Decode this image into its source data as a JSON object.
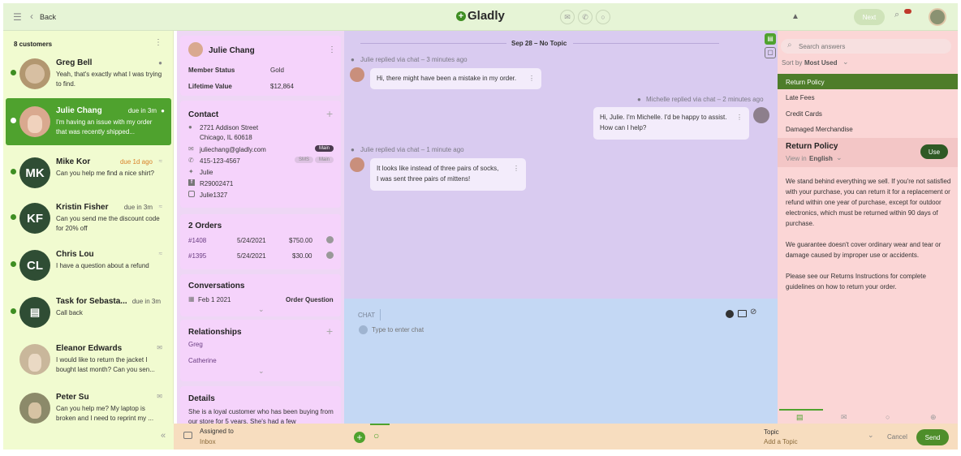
{
  "header": {
    "back_label": "Back",
    "logo": "Gladly",
    "next_label": "Next"
  },
  "customers": {
    "count_label": "8 customers",
    "items": [
      {
        "name": "Greg Bell",
        "due": "",
        "message": "Yeah, that's exactly what I was trying to find.",
        "initials": ""
      },
      {
        "name": "Julie Chang",
        "due": "due in 3m",
        "message": "I'm having an issue with my order that was recently shipped...",
        "initials": ""
      },
      {
        "name": "Mike Kor",
        "due": "due 1d ago",
        "message": "Can you help me find a nice shirt?",
        "initials": "MK"
      },
      {
        "name": "Kristin Fisher",
        "due": "due in 3m",
        "message": "Can you send me the discount code for 20% off",
        "initials": "KF"
      },
      {
        "name": "Chris Lou",
        "due": "",
        "message": "I have a question about a refund",
        "initials": "CL"
      },
      {
        "name": "Task for Sebasta...",
        "due": "due in 3m",
        "message": "Call back",
        "initials": ""
      },
      {
        "name": "Eleanor Edwards",
        "due": "",
        "message": "I would like to return the jacket I bought last month? Can you sen...",
        "initials": ""
      },
      {
        "name": "Peter Su",
        "due": "",
        "message": "Can you help me? My laptop is broken and I need to reprint my ...",
        "initials": ""
      }
    ]
  },
  "profile": {
    "name": "Julie Chang",
    "member_status_label": "Member Status",
    "member_status": "Gold",
    "lifetime_value_label": "Lifetime Value",
    "lifetime_value": "$12,864",
    "contact_title": "Contact",
    "address1": "2721 Addison Street",
    "address2": "Chicago, IL 60618",
    "email": "juliechang@gladly.com",
    "main_tag": "Main",
    "phone": "415-123-4567",
    "sms_tag": "SMS",
    "main_tag2": "Main",
    "twitter": "Julie",
    "facebook": "R29002471",
    "instagram": "Julie1327",
    "orders_title": "2 Orders",
    "orders": [
      {
        "id": "#1408",
        "date": "5/24/2021",
        "amount": "$750.00"
      },
      {
        "id": "#1395",
        "date": "5/24/2021",
        "amount": "$30.00"
      }
    ],
    "conversations_title": "Conversations",
    "conv_date": "Feb 1 2021",
    "conv_topic": "Order Question",
    "relationships_title": "Relationships",
    "rel1": "Greg",
    "rel2": "Catherine",
    "details_title": "Details",
    "details_text": "She is a loyal customer who has been buying from our store for 5 years. She's had a few"
  },
  "chat": {
    "date_divider": "Sep 28 – No Topic",
    "meta1": "Julie replied via chat – 3 minutes ago",
    "msg1": "Hi, there might have been a mistake in my order.",
    "meta2": "Michelle replied via chat – 2 minutes ago",
    "msg2a": "Hi, Julie. I'm Michelle. I'd be happy to assist.",
    "msg2b": "How can I help?",
    "meta3": "Julie replied via chat – 1 minute ago",
    "msg3a": "It looks like instead of three pairs of socks,",
    "msg3b": "I was sent three pairs of mittens!"
  },
  "compose": {
    "channel_label": "CHAT",
    "placeholder": "Type to enter chat"
  },
  "answers": {
    "search_placeholder": "Search answers",
    "sort_prefix": "Sort by",
    "sort_value": "Most Used",
    "items": [
      "Return Policy",
      "Late Fees",
      "Credit Cards",
      "Damaged Merchandise"
    ],
    "title": "Return Policy",
    "use_label": "Use",
    "view_prefix": "View in",
    "view_lang": "English",
    "para1": "We stand behind everything we sell. If you're not satisfied with your purchase, you can return it for a replacement or refund within one year of purchase, except for outdoor electronics, which must be returned within 90 days of purchase.",
    "para2": "We guarantee doesn't cover ordinary wear and tear or damage caused by improper use or accidents.",
    "para3": "Please see our Returns Instructions for complete guidelines on how to return your order."
  },
  "footer": {
    "assigned_label": "Assigned to",
    "assigned_value": "Inbox",
    "topic_label": "Topic",
    "topic_value": "Add a Topic",
    "cancel_label": "Cancel",
    "send_label": "Send"
  },
  "colors": {
    "brand_green": "#4fa22e",
    "dark_green": "#2f4d34",
    "due_orange": "#d9822b"
  }
}
